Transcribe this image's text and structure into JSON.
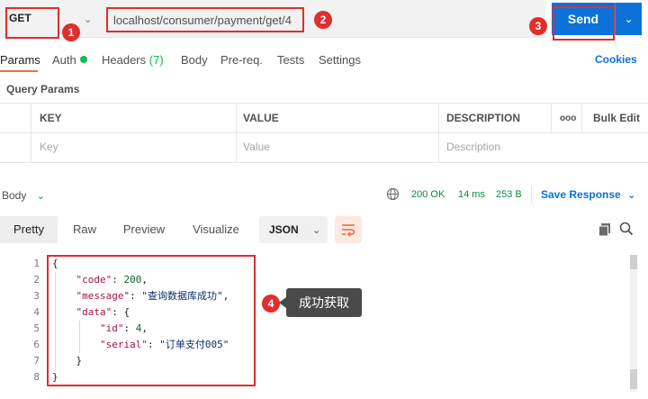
{
  "request": {
    "method": "GET",
    "url": "localhost/consumer/payment/get/4",
    "send_label": "Send"
  },
  "annotations": {
    "b1": "1",
    "b2": "2",
    "b3": "3",
    "b4": "4",
    "tooltip": "成功获取",
    "color": "#e02d2d"
  },
  "tabs": {
    "params": "Params",
    "auth": "Auth",
    "headers": "Headers",
    "headers_count": "(7)",
    "body": "Body",
    "prereq": "Pre-req.",
    "tests": "Tests",
    "settings": "Settings",
    "cookies": "Cookies"
  },
  "query_params": {
    "title": "Query Params",
    "headers": {
      "key": "KEY",
      "value": "VALUE",
      "description": "DESCRIPTION",
      "more": "ooo",
      "bulk": "Bulk Edit"
    },
    "placeholders": {
      "key": "Key",
      "value": "Value",
      "description": "Description"
    }
  },
  "response": {
    "label": "Body",
    "status": "200 OK",
    "time": "14 ms",
    "size": "253 B",
    "save": "Save Response",
    "views": {
      "pretty": "Pretty",
      "raw": "Raw",
      "preview": "Preview",
      "visualize": "Visualize"
    },
    "format": "JSON",
    "line_numbers": [
      "1",
      "2",
      "3",
      "4",
      "5",
      "6",
      "7",
      "8"
    ],
    "json": {
      "code_key": "\"code\"",
      "code_val": "200",
      "message_key": "\"message\"",
      "message_val": "\"查询数据库成功\"",
      "data_key": "\"data\"",
      "id_key": "\"id\"",
      "id_val": "4",
      "serial_key": "\"serial\"",
      "serial_val": "\"订单支付005\""
    }
  },
  "colors": {
    "accent": "#0b72d9",
    "active_tab": "#f26b3a",
    "success": "#0c8a3f"
  }
}
